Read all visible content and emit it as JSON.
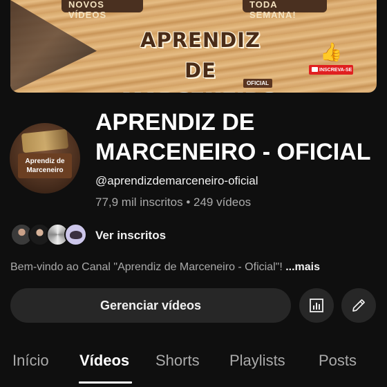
{
  "banner": {
    "tag_left": "NOVOS VÍDEOS",
    "tag_right": "TODA SEMANA!",
    "title_line1": "APRENDIZ DE",
    "title_line2": "MARCENEIRO",
    "badge": "OFICIAL",
    "subscribe_label": "INSCREVA-SE"
  },
  "avatar": {
    "line1": "Aprendiz de",
    "line2": "Marceneiro"
  },
  "channel": {
    "name": "APRENDIZ DE MARCENEIRO - OFICIAL",
    "handle": "@aprendizdemarceneiro-oficial",
    "stats": "77,9 mil inscritos • 249 vídeos"
  },
  "subscribers": {
    "label": "Ver inscritos"
  },
  "description": {
    "text": "Bem-vindo ao Canal \"Aprendiz de Marceneiro - Oficial\"! ",
    "more": "...mais"
  },
  "actions": {
    "manage_label": "Gerenciar vídeos"
  },
  "tabs": [
    {
      "label": "Início"
    },
    {
      "label": "Vídeos"
    },
    {
      "label": "Shorts"
    },
    {
      "label": "Playlists"
    },
    {
      "label": "Posts"
    }
  ],
  "active_tab": "Vídeos",
  "colors": {
    "background": "#0f0f0f",
    "button_bg": "#272727",
    "text_primary": "#f1f1f1",
    "text_secondary": "#aaaaaa"
  },
  "icons": {
    "analytics": "analytics-icon",
    "edit": "pencil-icon",
    "like": "thumbs-up-icon"
  }
}
